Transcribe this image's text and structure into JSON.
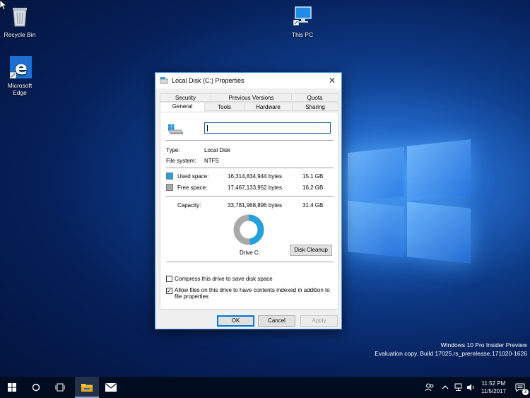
{
  "desktop": {
    "icons": [
      {
        "label": "Recycle Bin",
        "icon": "recycle-bin-icon"
      },
      {
        "label": "This PC",
        "icon": "this-pc-icon"
      },
      {
        "label": "Microsoft\nEdge",
        "label_line1": "Microsoft",
        "label_line2": "Edge",
        "icon": "edge-icon"
      }
    ]
  },
  "dialog": {
    "title": "Local Disk (C:) Properties",
    "tabs_row1": [
      "Security",
      "Previous Versions",
      "Quota"
    ],
    "tabs_row2": [
      "General",
      "Tools",
      "Hardware",
      "Sharing"
    ],
    "active_tab": "General",
    "name_value": "",
    "type_label": "Type:",
    "type_value": "Local Disk",
    "fs_label": "File system:",
    "fs_value": "NTFS",
    "used_label": "Used space:",
    "used_bytes": "16,314,834,944 bytes",
    "used_gb": "15.1 GB",
    "free_label": "Free space:",
    "free_bytes": "17,467,133,952 bytes",
    "free_gb": "16.2 GB",
    "capacity_label": "Capacity:",
    "capacity_bytes": "33,781,968,896 bytes",
    "capacity_gb": "31.4 GB",
    "used_fraction": 0.483,
    "drive_label": "Drive C:",
    "disk_cleanup": "Disk Cleanup",
    "compress_label": "Compress this drive to save disk space",
    "compress_checked": false,
    "index_label_line1": "Allow files on this drive to have contents indexed in addition to",
    "index_label_line2": "file properties",
    "index_checked": true,
    "ok": "OK",
    "cancel": "Cancel",
    "apply": "Apply",
    "colors": {
      "used": "#26a0da",
      "free": "#a9a9a9"
    }
  },
  "watermark": {
    "line1": "Windows 10 Pro Insider Preview",
    "line2": "Evaluation copy. Build 17025.rs_prerelease.171020-1626"
  },
  "taskbar": {
    "time": "11:52 PM",
    "date": "11/5/2017",
    "notification_count": "3"
  }
}
